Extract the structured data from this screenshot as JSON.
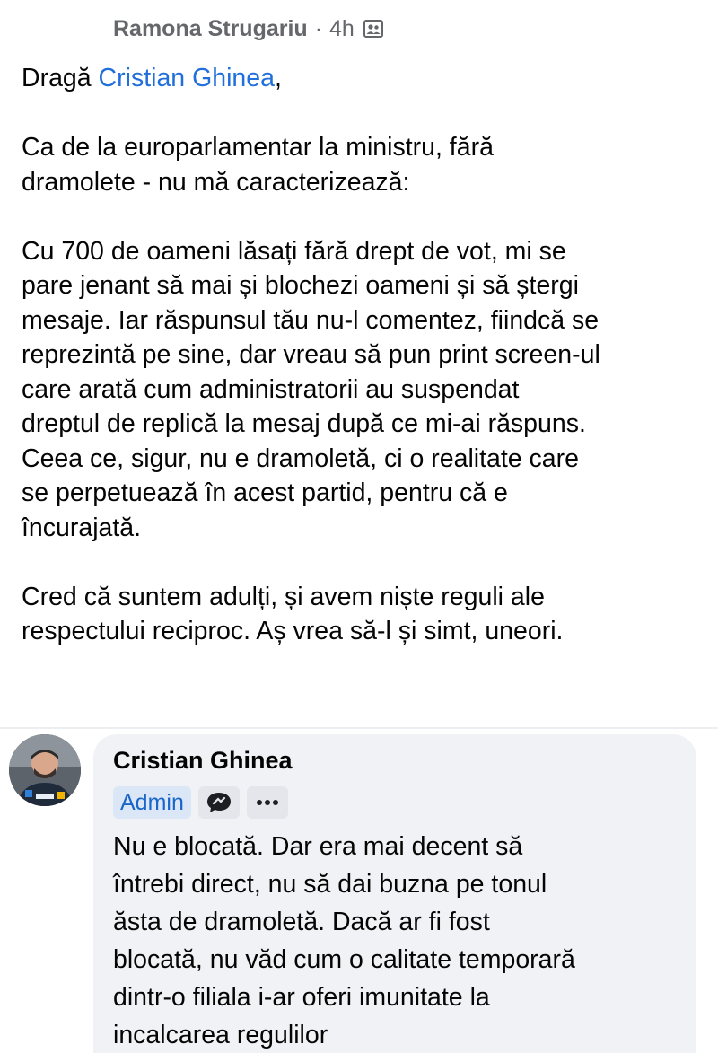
{
  "post": {
    "author": "Ramona Strugariu",
    "separator": "·",
    "time": "4h",
    "audience_icon": "group-icon",
    "greeting_prefix": "Dragă ",
    "greeting_mention": "Cristian Ghinea",
    "greeting_suffix": ",",
    "paragraph_1": [
      "Ca de la europarlamentar la ministru, fără",
      "dramolete - nu mă caracterizează:"
    ],
    "paragraph_2": [
      "Cu 700 de oameni lăsați fără drept de vot, mi se",
      "pare jenant să mai și blochezi oameni și să ștergi",
      "mesaje. Iar răspunsul tău nu-l comentez, fiindcă se",
      "reprezintă pe sine, dar vreau să pun print screen-ul",
      "care arată cum administratorii au suspendat",
      "dreptul de replică la mesaj după ce mi-ai răspuns.",
      "Ceea ce, sigur, nu e dramoletă, ci o realitate care",
      "se perpetuează în acest partid, pentru că e",
      "încurajată."
    ],
    "paragraph_3": [
      "Cred că suntem adulți, și avem niște reguli ale",
      "respectului reciproc. Aș vrea să-l și simt, uneori."
    ]
  },
  "comment": {
    "author": "Cristian Ghinea",
    "badge_admin": "Admin",
    "badge_icon": "speech-bubble-icon",
    "more_icon": "more-options-icon",
    "lines": [
      "Nu e blocată. Dar era mai decent să",
      "întrebi direct, nu să dai buzna pe tonul",
      "ăsta de dramoletă. Dacă ar fi fost",
      "blocată, nu văd cum o calitate temporară",
      "dintr-o filiala i-ar oferi imunitate la",
      "incalcarea regulilor"
    ]
  },
  "colors": {
    "mention": "#216fdb",
    "bubble": "#f0f2f5",
    "admin_badge_bg": "#dbe7f6",
    "admin_badge_text": "#1b66c9",
    "meta_text": "#65676b"
  }
}
